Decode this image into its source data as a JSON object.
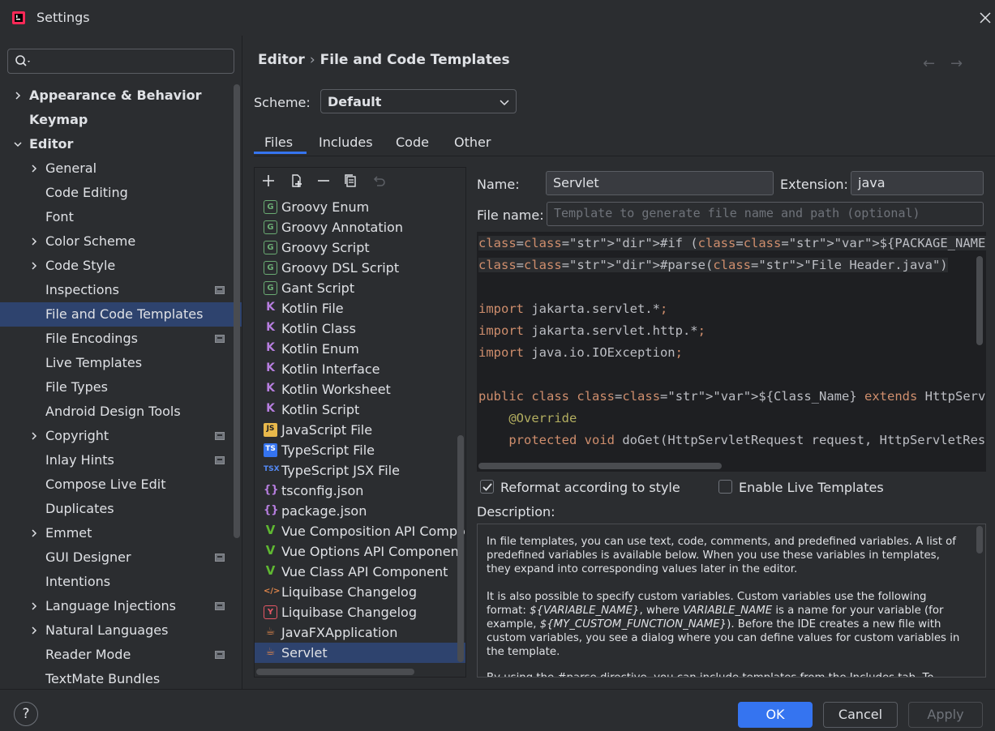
{
  "window": {
    "title": "Settings"
  },
  "colors": {
    "accent": "#3574f0",
    "selection": "#2e436e",
    "background": "#2b2d30",
    "editor_bg": "#1e1f22"
  },
  "sidebar": {
    "search_placeholder": "",
    "items": [
      {
        "label": "Appearance & Behavior",
        "level": 0,
        "expandable": true,
        "expanded": false,
        "bold": true,
        "project": false,
        "selected": false
      },
      {
        "label": "Keymap",
        "level": 0,
        "expandable": false,
        "expanded": false,
        "bold": true,
        "project": false,
        "selected": false
      },
      {
        "label": "Editor",
        "level": 0,
        "expandable": true,
        "expanded": true,
        "bold": true,
        "project": false,
        "selected": false
      },
      {
        "label": "General",
        "level": 1,
        "expandable": true,
        "expanded": false,
        "bold": false,
        "project": false,
        "selected": false
      },
      {
        "label": "Code Editing",
        "level": 1,
        "expandable": false,
        "expanded": false,
        "bold": false,
        "project": false,
        "selected": false
      },
      {
        "label": "Font",
        "level": 1,
        "expandable": false,
        "expanded": false,
        "bold": false,
        "project": false,
        "selected": false
      },
      {
        "label": "Color Scheme",
        "level": 1,
        "expandable": true,
        "expanded": false,
        "bold": false,
        "project": false,
        "selected": false
      },
      {
        "label": "Code Style",
        "level": 1,
        "expandable": true,
        "expanded": false,
        "bold": false,
        "project": false,
        "selected": false
      },
      {
        "label": "Inspections",
        "level": 1,
        "expandable": false,
        "expanded": false,
        "bold": false,
        "project": true,
        "selected": false
      },
      {
        "label": "File and Code Templates",
        "level": 1,
        "expandable": false,
        "expanded": false,
        "bold": false,
        "project": false,
        "selected": true
      },
      {
        "label": "File Encodings",
        "level": 1,
        "expandable": false,
        "expanded": false,
        "bold": false,
        "project": true,
        "selected": false
      },
      {
        "label": "Live Templates",
        "level": 1,
        "expandable": false,
        "expanded": false,
        "bold": false,
        "project": false,
        "selected": false
      },
      {
        "label": "File Types",
        "level": 1,
        "expandable": false,
        "expanded": false,
        "bold": false,
        "project": false,
        "selected": false
      },
      {
        "label": "Android Design Tools",
        "level": 1,
        "expandable": false,
        "expanded": false,
        "bold": false,
        "project": false,
        "selected": false
      },
      {
        "label": "Copyright",
        "level": 1,
        "expandable": true,
        "expanded": false,
        "bold": false,
        "project": true,
        "selected": false
      },
      {
        "label": "Inlay Hints",
        "level": 1,
        "expandable": false,
        "expanded": false,
        "bold": false,
        "project": true,
        "selected": false
      },
      {
        "label": "Compose Live Edit",
        "level": 1,
        "expandable": false,
        "expanded": false,
        "bold": false,
        "project": false,
        "selected": false
      },
      {
        "label": "Duplicates",
        "level": 1,
        "expandable": false,
        "expanded": false,
        "bold": false,
        "project": false,
        "selected": false
      },
      {
        "label": "Emmet",
        "level": 1,
        "expandable": true,
        "expanded": false,
        "bold": false,
        "project": false,
        "selected": false
      },
      {
        "label": "GUI Designer",
        "level": 1,
        "expandable": false,
        "expanded": false,
        "bold": false,
        "project": true,
        "selected": false
      },
      {
        "label": "Intentions",
        "level": 1,
        "expandable": false,
        "expanded": false,
        "bold": false,
        "project": false,
        "selected": false
      },
      {
        "label": "Language Injections",
        "level": 1,
        "expandable": true,
        "expanded": false,
        "bold": false,
        "project": true,
        "selected": false
      },
      {
        "label": "Natural Languages",
        "level": 1,
        "expandable": true,
        "expanded": false,
        "bold": false,
        "project": false,
        "selected": false
      },
      {
        "label": "Reader Mode",
        "level": 1,
        "expandable": false,
        "expanded": false,
        "bold": false,
        "project": true,
        "selected": false
      },
      {
        "label": "TextMate Bundles",
        "level": 1,
        "expandable": false,
        "expanded": false,
        "bold": false,
        "project": false,
        "selected": false
      }
    ]
  },
  "main": {
    "breadcrumb": {
      "parent": "Editor",
      "separator": "›",
      "current": "File and Code Templates"
    },
    "nav": {
      "back": "←",
      "forward": "→"
    },
    "scheme": {
      "label": "Scheme:",
      "value": "Default"
    },
    "tabs": [
      {
        "label": "Files",
        "active": true
      },
      {
        "label": "Includes",
        "active": false
      },
      {
        "label": "Code",
        "active": false
      },
      {
        "label": "Other",
        "active": false
      }
    ],
    "templates": [
      {
        "label": "Groovy Enum",
        "icon": "groovy-icon",
        "glyph": "G",
        "color": "#6aab73",
        "selected": false
      },
      {
        "label": "Groovy Annotation",
        "icon": "groovy-icon",
        "glyph": "G",
        "color": "#6aab73",
        "selected": false
      },
      {
        "label": "Groovy Script",
        "icon": "groovy-icon",
        "glyph": "G",
        "color": "#6aab73",
        "selected": false
      },
      {
        "label": "Groovy DSL Script",
        "icon": "groovy-icon",
        "glyph": "G",
        "color": "#6aab73",
        "selected": false
      },
      {
        "label": "Gant Script",
        "icon": "groovy-icon",
        "glyph": "G",
        "color": "#6aab73",
        "selected": false
      },
      {
        "label": "Kotlin File",
        "icon": "kotlin-icon",
        "glyph": "K",
        "color": "#b77ee0",
        "selected": false
      },
      {
        "label": "Kotlin Class",
        "icon": "kotlin-icon",
        "glyph": "K",
        "color": "#b77ee0",
        "selected": false
      },
      {
        "label": "Kotlin Enum",
        "icon": "kotlin-icon",
        "glyph": "K",
        "color": "#b77ee0",
        "selected": false
      },
      {
        "label": "Kotlin Interface",
        "icon": "kotlin-icon",
        "glyph": "K",
        "color": "#b77ee0",
        "selected": false
      },
      {
        "label": "Kotlin Worksheet",
        "icon": "kotlin-icon",
        "glyph": "K",
        "color": "#b77ee0",
        "selected": false
      },
      {
        "label": "Kotlin Script",
        "icon": "kotlin-icon",
        "glyph": "K",
        "color": "#b77ee0",
        "selected": false
      },
      {
        "label": "JavaScript File",
        "icon": "javascript-icon",
        "glyph": "JS",
        "color": "#e8b84b",
        "selected": false
      },
      {
        "label": "TypeScript File",
        "icon": "typescript-icon",
        "glyph": "TS",
        "color": "#3574f0",
        "selected": false
      },
      {
        "label": "TypeScript JSX File",
        "icon": "tsx-icon",
        "glyph": "TSX",
        "color": "#548af7",
        "selected": false
      },
      {
        "label": "tsconfig.json",
        "icon": "json-icon",
        "glyph": "{}",
        "color": "#b77ee0",
        "selected": false
      },
      {
        "label": "package.json",
        "icon": "json-icon",
        "glyph": "{}",
        "color": "#b77ee0",
        "selected": false
      },
      {
        "label": "Vue Composition API Component",
        "icon": "vue-icon",
        "glyph": "V",
        "color": "#5fb832",
        "selected": false
      },
      {
        "label": "Vue Options API Component",
        "icon": "vue-icon",
        "glyph": "V",
        "color": "#5fb832",
        "selected": false
      },
      {
        "label": "Vue Class API Component",
        "icon": "vue-icon",
        "glyph": "V",
        "color": "#5fb832",
        "selected": false
      },
      {
        "label": "Liquibase Changelog",
        "icon": "xml-icon",
        "glyph": "</>",
        "color": "#e0864b",
        "selected": false
      },
      {
        "label": "Liquibase Changelog",
        "icon": "yaml-icon",
        "glyph": "Y",
        "color": "#e55765",
        "selected": false
      },
      {
        "label": "JavaFXApplication",
        "icon": "java-icon",
        "glyph": "☕",
        "color": "#e0864b",
        "selected": false
      },
      {
        "label": "Servlet",
        "icon": "java-icon",
        "glyph": "☕",
        "color": "#e0864b",
        "selected": true
      }
    ],
    "form": {
      "name_label": "Name:",
      "name_value": "Servlet",
      "extension_label": "Extension:",
      "extension_value": "java",
      "filename_label": "File name:",
      "filename_placeholder": "Template to generate file name and path (optional)"
    },
    "code_lines": [
      "#if (${PACKAGE_NAME} && ${PACKAGE_NAME} != \"\")package ${PACKAGE_NAME};#end",
      "#parse(\"File Header.java\")",
      "",
      "import jakarta.servlet.*;",
      "import jakarta.servlet.http.*;",
      "import java.io.IOException;",
      "",
      "public class ${Class_Name} extends HttpServlet {",
      "    @Override",
      "    protected void doGet(HttpServletRequest request, HttpServletResponse response)"
    ],
    "options": {
      "reformat_label": "Reformat according to style",
      "reformat_checked": true,
      "live_label": "Enable Live Templates",
      "live_checked": false
    },
    "description": {
      "label": "Description:",
      "p1": "In file templates, you can use text, code, comments, and predefined variables. A list of predefined variables is available below. When you use these variables in templates, they expand into corresponding values later in the editor.",
      "p2_a": "It is also possible to specify custom variables. Custom variables use the following format: ",
      "p2_var1": "${VARIABLE_NAME}",
      "p2_b": ", where ",
      "p2_var2": "VARIABLE_NAME",
      "p2_c": " is a name for your variable (for example, ",
      "p2_var3": "${MY_CUSTOM_FUNCTION_NAME}",
      "p2_d": "). Before the IDE creates a new file with custom variables, you see a dialog where you can define values for custom variables in the template.",
      "p3": "By using the #parse directive, you can include templates from the Includes tab. To"
    }
  },
  "footer": {
    "help": "?",
    "ok": "OK",
    "cancel": "Cancel",
    "apply": "Apply"
  }
}
